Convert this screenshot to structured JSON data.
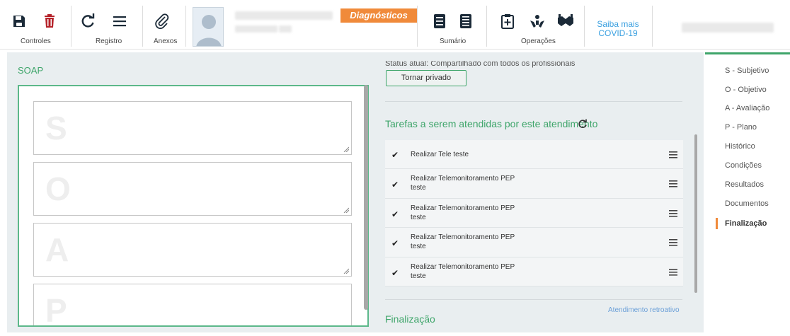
{
  "toolbar": {
    "controles_label": "Controles",
    "registro_label": "Registro",
    "anexos_label": "Anexos",
    "diagnosticos_label": "Diagnósticos",
    "sumario_label": "Sumário",
    "operacoes_label": "Operações",
    "covid_link": "Saiba mais COVID-19",
    "icons": [
      "save-icon",
      "trash-icon",
      "refresh-icon",
      "hamburger-icon",
      "paperclip-icon",
      "user-avatar",
      "list-icon",
      "document-icon",
      "medical-plus-icon",
      "caring-hands-icon",
      "handshake-icon"
    ]
  },
  "soap": {
    "title": "SOAP",
    "letters": [
      "S",
      "O",
      "A",
      "P"
    ]
  },
  "status": {
    "text": "Status atual: Compartilhado com todos os profissionais",
    "private_button": "Tornar privado"
  },
  "tasks": {
    "title": "Tarefas a serem atendidas por este atendimento",
    "items": [
      {
        "checked": true,
        "label": "Realizar Tele teste"
      },
      {
        "checked": true,
        "label": "Realizar Telemonitoramento PEP teste"
      },
      {
        "checked": true,
        "label": "Realizar Telemonitoramento PEP teste"
      },
      {
        "checked": true,
        "label": "Realizar Telemonitoramento PEP teste"
      },
      {
        "checked": true,
        "label": "Realizar Telemonitoramento PEP teste"
      }
    ]
  },
  "finalizacao": {
    "title": "Finalização",
    "retro_link": "Atendimento retroativo"
  },
  "right_nav": {
    "items": [
      "S - Subjetivo",
      "O - Objetivo",
      "A - Avaliação",
      "P - Plano",
      "Histórico",
      "Condições",
      "Resultados",
      "Documentos",
      "Finalização"
    ],
    "active": "Finalização"
  },
  "colors": {
    "accent_green": "#3ea56a",
    "accent_orange": "#f08a3a",
    "link_blue": "#3aa0e0"
  }
}
